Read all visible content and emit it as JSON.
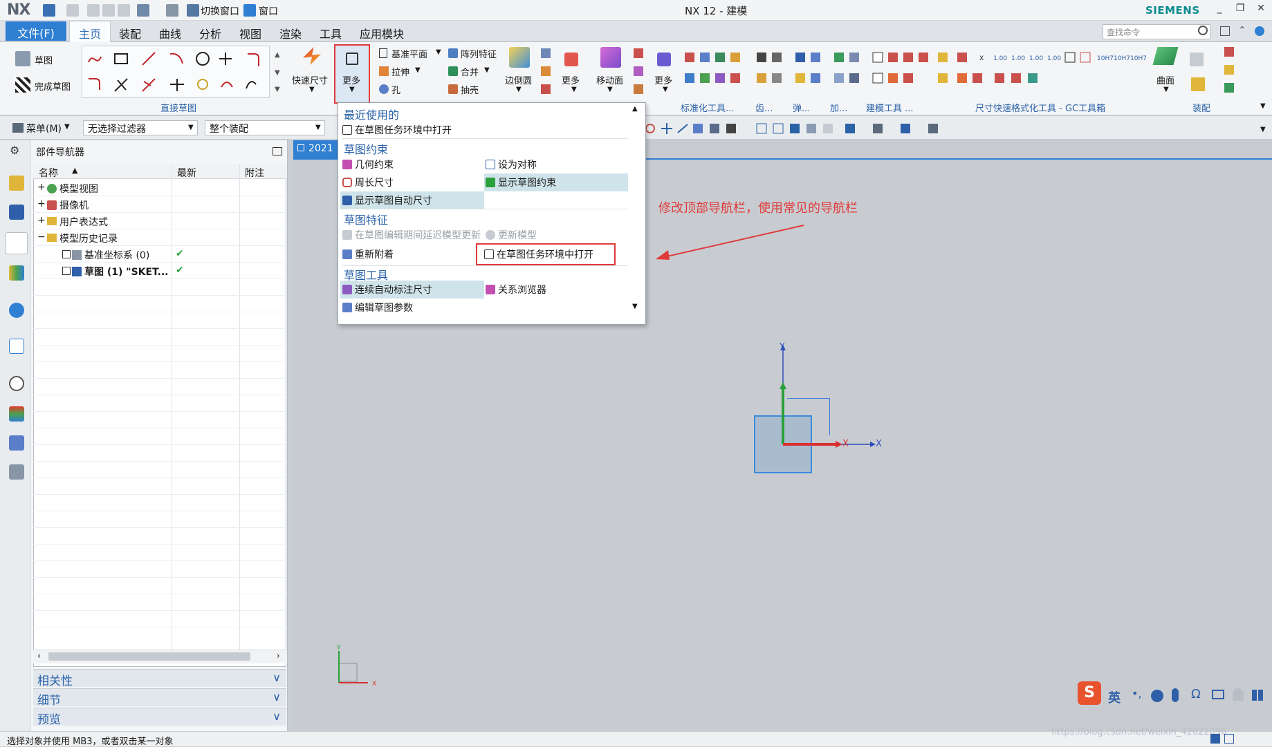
{
  "window": {
    "logo": "NX",
    "title": "NX 12 - 建模",
    "brand": "SIEMENS",
    "quick_access": [
      "切换窗口",
      "窗口"
    ],
    "controls": [
      "_",
      "❐",
      "✕"
    ]
  },
  "menu": {
    "file": "文件(F)",
    "tabs": [
      "主页",
      "装配",
      "曲线",
      "分析",
      "视图",
      "渲染",
      "工具",
      "应用模块"
    ],
    "active_tab": "主页",
    "search_placeholder": "查找命令"
  },
  "ribbon": {
    "sketch": "草图",
    "finish_sketch": "完成草图",
    "group_direct_sketch": "直接草图",
    "quick_dimension": "快速尺寸",
    "more_1": "更多",
    "datum_plane": "基准平面",
    "extrude": "拉伸",
    "hole": "孔",
    "pattern_feature": "阵列特征",
    "unite": "合并",
    "shell": "抽壳",
    "edge_blend": "边倒圆",
    "more_2": "更多",
    "move_face": "移动面",
    "more_3": "更多",
    "surface": "曲面",
    "group_standard_tools": "标准化工具...",
    "group_gear": "齿...",
    "group_spring": "弹...",
    "group_add": "加...",
    "group_modeling_tools": "建模工具 ...",
    "group_gc": "尺寸快速格式化工具 - GC工具箱",
    "group_assembly": "装配"
  },
  "toolbar2": {
    "menu": "菜单(M)",
    "filter": "无选择过滤器",
    "scope": "整个装配"
  },
  "navigator": {
    "title": "部件导航器",
    "columns": [
      "名称",
      "最新",
      "附注"
    ],
    "rows": [
      {
        "expander": "+",
        "label": "模型视图",
        "latest": ""
      },
      {
        "expander": "+",
        "label": "摄像机",
        "latest": ""
      },
      {
        "expander": "+",
        "label": "用户表达式",
        "latest": ""
      },
      {
        "expander": "−",
        "label": "模型历史记录",
        "latest": ""
      },
      {
        "expander": "",
        "label": "基准坐标系 (0)",
        "latest": "✔"
      },
      {
        "expander": "",
        "label": "草图 (1) \"SKET...",
        "latest": "✔"
      }
    ],
    "accordion": [
      "相关性",
      "细节",
      "预览"
    ]
  },
  "viewport": {
    "tab_label": "2021",
    "annotation": "修改顶部导航栏，使用常见的导航栏",
    "axis_x": "X",
    "axis_y": "Y"
  },
  "dropdown": {
    "sections": [
      {
        "title": "最近使用的",
        "items": [
          {
            "label": "在草图任务环境中打开"
          }
        ]
      },
      {
        "title": "草图约束",
        "items": [
          {
            "label": "几何约束"
          },
          {
            "label": "设为对称"
          },
          {
            "label": "周长尺寸"
          },
          {
            "label": "显示草图约束"
          },
          {
            "label": "显示草图自动尺寸"
          }
        ]
      },
      {
        "title": "草图特征",
        "items": [
          {
            "label": "在草图编辑期间延迟模型更新"
          },
          {
            "label": "更新模型"
          },
          {
            "label": "重新附着"
          },
          {
            "label": "在草图任务环境中打开"
          }
        ]
      },
      {
        "title": "草图工具",
        "items": [
          {
            "label": "连续自动标注尺寸"
          },
          {
            "label": "关系浏览器"
          },
          {
            "label": "编辑草图参数"
          }
        ]
      }
    ]
  },
  "statusbar": {
    "message": "选择对象并使用 MB3，或者双击某一对象",
    "watermark": "https://blog.csdn.net/weixin_42022096"
  },
  "ime": {
    "lang": "英"
  },
  "colors": {
    "accent": "#2f7fd3",
    "annotation_red": "#e03a3a",
    "check_green": "#2fa43a"
  }
}
